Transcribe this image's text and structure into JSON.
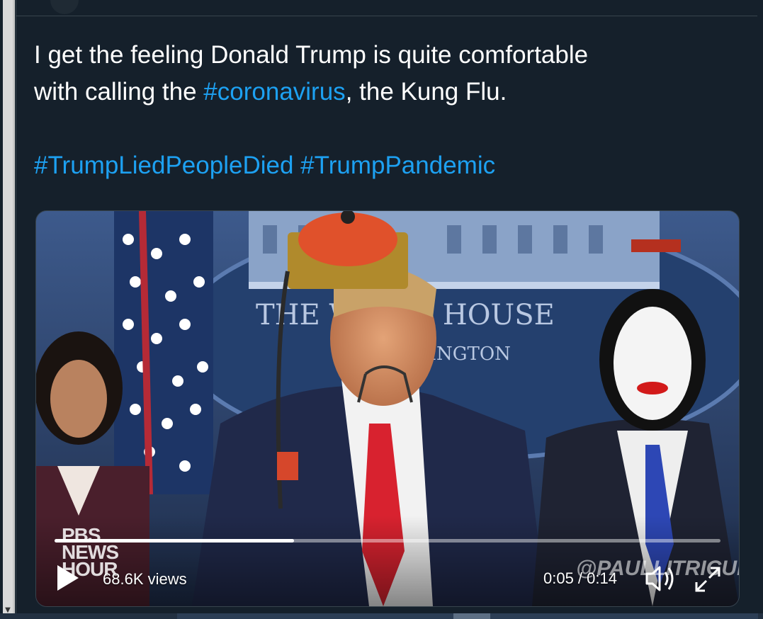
{
  "tweet": {
    "line1": "I get the feeling Donald Trump is quite comfortable",
    "line2_prefix": "with calling the ",
    "line2_tag": "#coronavirus",
    "line2_suffix": ", the Kung Flu.",
    "tag1": "#TrumpLiedPeopleDied",
    "tag2": "#TrumpPandemic"
  },
  "video": {
    "views": "68.6K views",
    "timecode": "0:05 / 0:14",
    "progress": 0.36,
    "watermark_pbs": [
      "PBS",
      "NEWS",
      "HOUR"
    ],
    "watermark_credit": "@PAULLITRICUL",
    "backdrop_text_1": "THE WHITE HOUSE",
    "backdrop_text_2": "WASHINGTON"
  },
  "icons": {
    "play": "play-icon",
    "volume": "volume-icon",
    "fullscreen": "fullscreen-icon"
  },
  "colors": {
    "background": "#15202b",
    "link": "#1da1f2",
    "text": "#ffffff",
    "border": "#38444d"
  }
}
